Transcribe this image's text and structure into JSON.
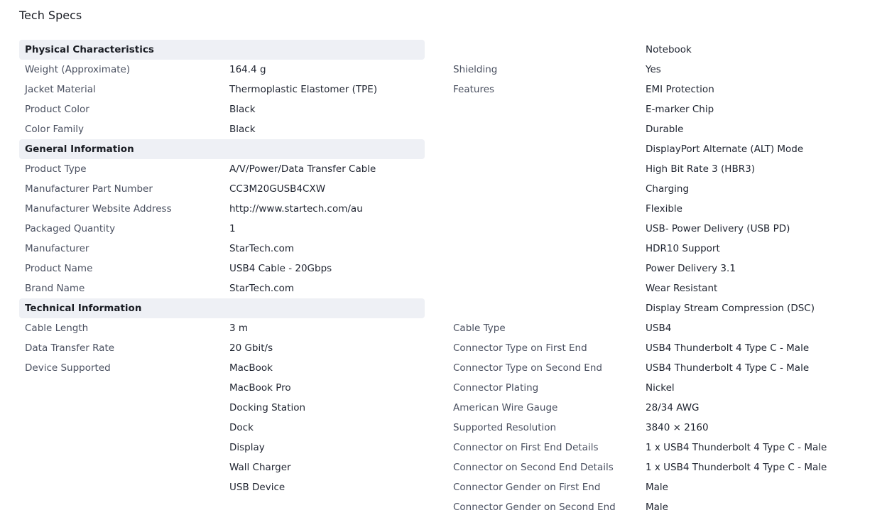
{
  "title": "Tech Specs",
  "left_rows": [
    {
      "kind": "header",
      "text": "Physical Characteristics"
    },
    {
      "kind": "row",
      "label": "Weight (Approximate)",
      "value": "164.4 g"
    },
    {
      "kind": "row",
      "label": "Jacket Material",
      "value": "Thermoplastic Elastomer (TPE)"
    },
    {
      "kind": "row",
      "label": "Product Color",
      "value": "Black"
    },
    {
      "kind": "row",
      "label": "Color Family",
      "value": "Black"
    },
    {
      "kind": "header",
      "text": "General Information"
    },
    {
      "kind": "row",
      "label": "Product Type",
      "value": "A/V/Power/Data Transfer Cable"
    },
    {
      "kind": "row",
      "label": "Manufacturer Part Number",
      "value": "CC3M20GUSB4CXW"
    },
    {
      "kind": "row",
      "label": "Manufacturer Website Address",
      "value": "http://www.startech.com/au"
    },
    {
      "kind": "row",
      "label": "Packaged Quantity",
      "value": "1"
    },
    {
      "kind": "row",
      "label": "Manufacturer",
      "value": "StarTech.com"
    },
    {
      "kind": "row",
      "label": "Product Name",
      "value": "USB4 Cable - 20Gbps"
    },
    {
      "kind": "row",
      "label": "Brand Name",
      "value": "StarTech.com"
    },
    {
      "kind": "header",
      "text": "Technical Information"
    },
    {
      "kind": "row",
      "label": "Cable Length",
      "value": "3 m"
    },
    {
      "kind": "row",
      "label": "Data Transfer Rate",
      "value": "20 Gbit/s"
    },
    {
      "kind": "row",
      "label": "Device Supported",
      "value": "MacBook"
    },
    {
      "kind": "row",
      "label": "",
      "value": "MacBook Pro"
    },
    {
      "kind": "row",
      "label": "",
      "value": "Docking Station"
    },
    {
      "kind": "row",
      "label": "",
      "value": "Dock"
    },
    {
      "kind": "row",
      "label": "",
      "value": "Display"
    },
    {
      "kind": "row",
      "label": "",
      "value": "Wall Charger"
    },
    {
      "kind": "row",
      "label": "",
      "value": "USB Device"
    }
  ],
  "right_rows": [
    {
      "kind": "row",
      "label": "",
      "value": "Notebook"
    },
    {
      "kind": "row",
      "label": "Shielding",
      "value": "Yes"
    },
    {
      "kind": "row",
      "label": "Features",
      "value": "EMI Protection"
    },
    {
      "kind": "row",
      "label": "",
      "value": "E-marker Chip"
    },
    {
      "kind": "row",
      "label": "",
      "value": "Durable"
    },
    {
      "kind": "row",
      "label": "",
      "value": "DisplayPort Alternate (ALT) Mode"
    },
    {
      "kind": "row",
      "label": "",
      "value": "High Bit Rate 3 (HBR3)"
    },
    {
      "kind": "row",
      "label": "",
      "value": "Charging"
    },
    {
      "kind": "row",
      "label": "",
      "value": "Flexible"
    },
    {
      "kind": "row",
      "label": "",
      "value": "USB- Power Delivery (USB PD)"
    },
    {
      "kind": "row",
      "label": "",
      "value": "HDR10 Support"
    },
    {
      "kind": "row",
      "label": "",
      "value": "Power Delivery 3.1"
    },
    {
      "kind": "row",
      "label": "",
      "value": "Wear Resistant"
    },
    {
      "kind": "row",
      "label": "",
      "value": "Display Stream Compression (DSC)"
    },
    {
      "kind": "row",
      "label": "Cable Type",
      "value": "USB4"
    },
    {
      "kind": "row",
      "label": "Connector Type on First End",
      "value": "USB4 Thunderbolt 4 Type C - Male"
    },
    {
      "kind": "row",
      "label": "Connector Type on Second End",
      "value": "USB4 Thunderbolt 4 Type C - Male"
    },
    {
      "kind": "row",
      "label": "Connector Plating",
      "value": "Nickel"
    },
    {
      "kind": "row",
      "label": "American Wire Gauge",
      "value": "28/34 AWG"
    },
    {
      "kind": "row",
      "label": "Supported Resolution",
      "value": "3840 × 2160"
    },
    {
      "kind": "row",
      "label": "Connector on First End Details",
      "value": "1 x USB4 Thunderbolt 4 Type C - Male"
    },
    {
      "kind": "row",
      "label": "Connector on Second End Details",
      "value": "1 x USB4 Thunderbolt 4 Type C - Male"
    },
    {
      "kind": "row",
      "label": "Connector Gender on First End",
      "value": "Male"
    },
    {
      "kind": "row",
      "label": "Connector Gender on Second End",
      "value": "Male"
    }
  ]
}
